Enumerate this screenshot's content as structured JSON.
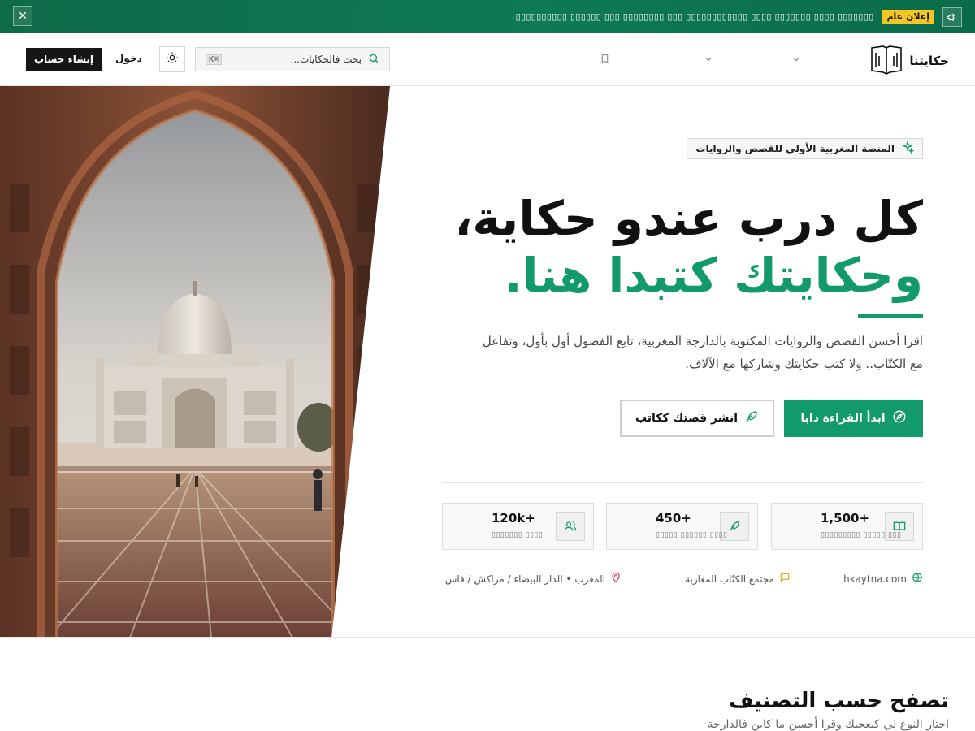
{
  "announcement": {
    "badge": "إعلان عام",
    "text": "▯▯▯▯▯▯▯ ▯▯▯▯ ▯▯▯▯▯▯▯ ▯▯▯▯ ▯▯▯▯▯▯▯▯▯▯▯▯ ▯▯▯ ▯▯▯▯▯▯▯▯ ▯▯▯ ▯▯▯▯▯▯ ▯▯▯▯▯▯▯▯▯▯.",
    "close_label": "✕"
  },
  "header": {
    "logo_text": "حكايتنا",
    "search_placeholder": "بحث فالحكايات...",
    "search_shortcut": "⌘K",
    "login_label": "دخول",
    "signup_label": "إنشاء حساب"
  },
  "hero": {
    "tagline": "المنصة المغربية الأولى للقصص والروايات",
    "title_line1": "كل درب عندو حكاية،",
    "title_line2": "وحكايتك كتبدا هنا.",
    "description": "اقرا أحسن القصص والروايات المكتوبة بالدارجة المغربية، تابع الفصول أول بأول، وتفاعل مع الكتّاب.. ولا كتب حكايتك وشاركها مع الآلاف.",
    "primary_button": "ابدأ القراءة دابا",
    "secondary_button": "انشر قصتك ككاتب",
    "image_description": "photo-taj-mahal-through-arch",
    "stats": [
      {
        "value": "1,500+",
        "label": "▯▯▯ ▯▯▯▯▯ ▯▯▯▯▯▯▯▯▯",
        "icon": "book-icon"
      },
      {
        "value": "450+",
        "label": "▯▯▯▯ ▯▯▯▯▯▯ ▯▯▯▯▯",
        "icon": "feather-icon"
      },
      {
        "value": "120k+",
        "label": "▯▯▯▯ ▯▯▯▯▯▯▯",
        "icon": "users-icon"
      }
    ],
    "meta": {
      "website": "hkaytna.com",
      "community": "مجتمع الكتّاب المغاربة",
      "location": "المغرب • الدار البيضاء / مراكش / فاس"
    }
  },
  "categories": {
    "title": "تصفح حسب التصنيف",
    "subtitle": "اختار النوع لي كيعجبك وقرا أحسن ما كاين فالدارجة"
  },
  "colors": {
    "accent": "#129a6a",
    "announcement_bg": "#0f6a48",
    "badge": "#f3c623",
    "dark_button": "#161616"
  }
}
